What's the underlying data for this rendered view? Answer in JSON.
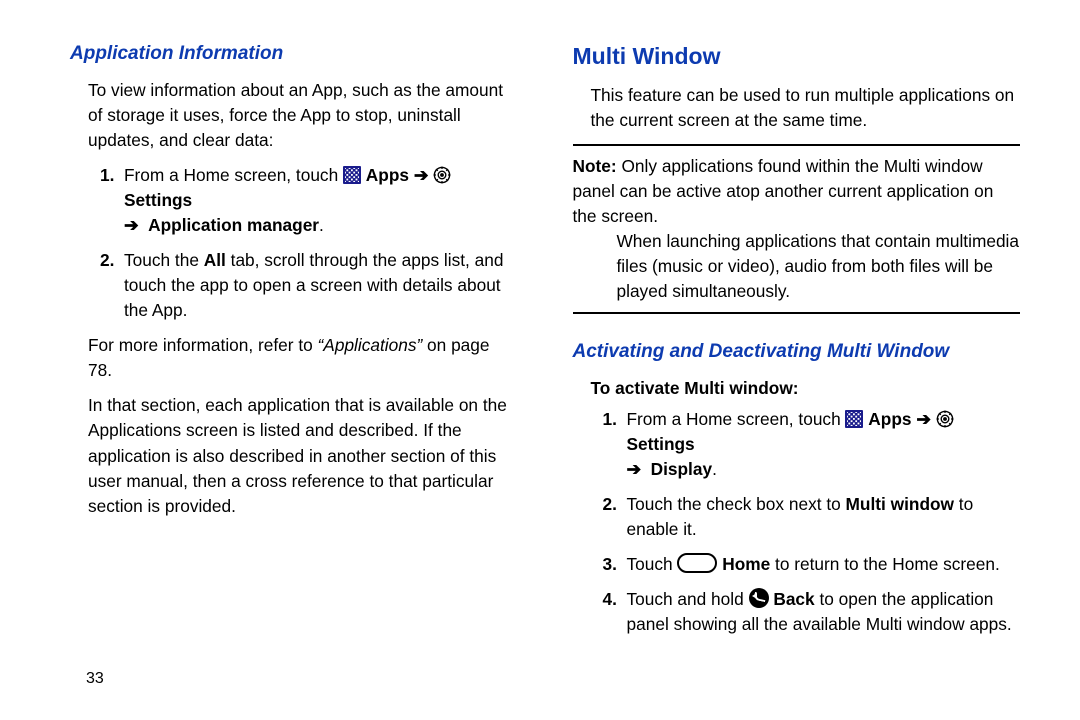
{
  "page_number": "33",
  "left": {
    "heading": "Application Information",
    "intro": "To view information about an App, such as the amount of storage it uses, force the App to stop, uninstall updates, and clear data:",
    "step1_pre": "From a Home screen, touch ",
    "apps_label": " Apps ",
    "arrow": "➔",
    "settings_label": " Settings ",
    "step1_tail": "Application manager",
    "step2_a": "Touch the ",
    "all_bold": "All",
    "step2_b": " tab, scroll through the apps list, and touch the app to open a screen with details about the App.",
    "ref_a": "For more information, refer to ",
    "ref_it": "“Applications”",
    "ref_b": " on page 78.",
    "para2": "In that section, each application that is available on the Applications screen is listed and described. If the application is also described in another section of this user manual, then a cross reference to that particular section is provided."
  },
  "right": {
    "heading": "Multi Window",
    "intro": "This feature can be used to run multiple applications on the current screen at the same time.",
    "note_label": "Note:",
    "note1": "Only applications found within the Multi window panel can be active atop another current application on the screen.",
    "note2": "When launching applications that contain multimedia files (music or video), audio from both files will be played simultaneously.",
    "sub_heading": "Activating and Deactivating Multi Window",
    "sub_bold": "To activate Multi window:",
    "s1_pre": "From a Home screen, touch ",
    "s1_tail": "Display",
    "s2_a": "Touch the check box next to ",
    "s2_bold": "Multi window",
    "s2_b": " to enable it.",
    "s3_a": "Touch ",
    "s3_bold": " Home",
    "s3_b": " to return to the Home screen.",
    "s4_a": "Touch and hold ",
    "s4_bold": " Back",
    "s4_b": " to open the application panel showing all the available Multi window apps."
  },
  "nums": {
    "n1": "1.",
    "n2": "2.",
    "n3": "3.",
    "n4": "4."
  },
  "period": "."
}
